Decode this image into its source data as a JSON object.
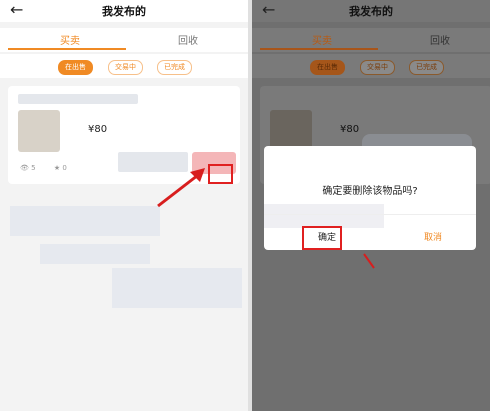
{
  "header": {
    "back_icon": "arrow-left-icon",
    "title": "我发布的"
  },
  "tabs": [
    {
      "label": "买卖"
    },
    {
      "label": "回收"
    }
  ],
  "filters": [
    {
      "label": "在出售"
    },
    {
      "label": "交易中"
    },
    {
      "label": "已完成"
    }
  ],
  "item": {
    "price": "¥80",
    "views": "5",
    "likes": "0",
    "view_icon": "eye-icon",
    "like_icon": "star-icon"
  },
  "dialog": {
    "message": "确定要删除该物品吗?",
    "confirm": "确定",
    "cancel": "取消"
  },
  "colors": {
    "accent": "#f08a24",
    "highlight": "#e02020",
    "overlay": "#6f6f6f"
  }
}
